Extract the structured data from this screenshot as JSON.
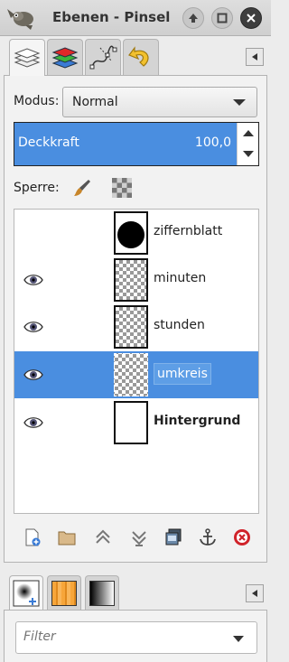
{
  "window": {
    "title": "Ebenen - Pinsel",
    "controls": [
      "up-icon",
      "maximize-icon",
      "close-icon"
    ]
  },
  "dock_tabs": [
    {
      "icon": "layers-icon",
      "active": true
    },
    {
      "icon": "channels-icon",
      "active": false
    },
    {
      "icon": "paths-icon",
      "active": false
    },
    {
      "icon": "undo-history-icon",
      "active": false
    }
  ],
  "mode": {
    "label": "Modus:",
    "value": "Normal"
  },
  "opacity": {
    "label": "Deckkraft",
    "value": "100,0",
    "fraction": 1.0
  },
  "lock": {
    "label": "Sperre:"
  },
  "layers": [
    {
      "name": "ziffernblatt",
      "visible": false,
      "selected": false,
      "bold": false,
      "thumb": "black-circle"
    },
    {
      "name": "minuten",
      "visible": true,
      "selected": false,
      "bold": false,
      "thumb": "transparent"
    },
    {
      "name": "stunden",
      "visible": true,
      "selected": false,
      "bold": false,
      "thumb": "transparent"
    },
    {
      "name": "umkreis",
      "visible": true,
      "selected": true,
      "bold": false,
      "thumb": "transparent"
    },
    {
      "name": "Hintergrund",
      "visible": true,
      "selected": false,
      "bold": true,
      "thumb": "white"
    }
  ],
  "layer_toolbar": [
    "new-layer-icon",
    "new-layer-group-icon",
    "raise-layer-icon",
    "lower-layer-icon",
    "duplicate-layer-icon",
    "anchor-layer-icon",
    "delete-layer-icon"
  ],
  "bottom_tabs": [
    {
      "icon": "brushes-icon",
      "active": true
    },
    {
      "icon": "patterns-icon",
      "active": false
    },
    {
      "icon": "gradients-icon",
      "active": false
    }
  ],
  "filter": {
    "placeholder": "Filter"
  },
  "colors": {
    "selection": "#4a8ee0",
    "opacity_bar": "#4a8ee0",
    "delete_red": "#d0232a"
  }
}
